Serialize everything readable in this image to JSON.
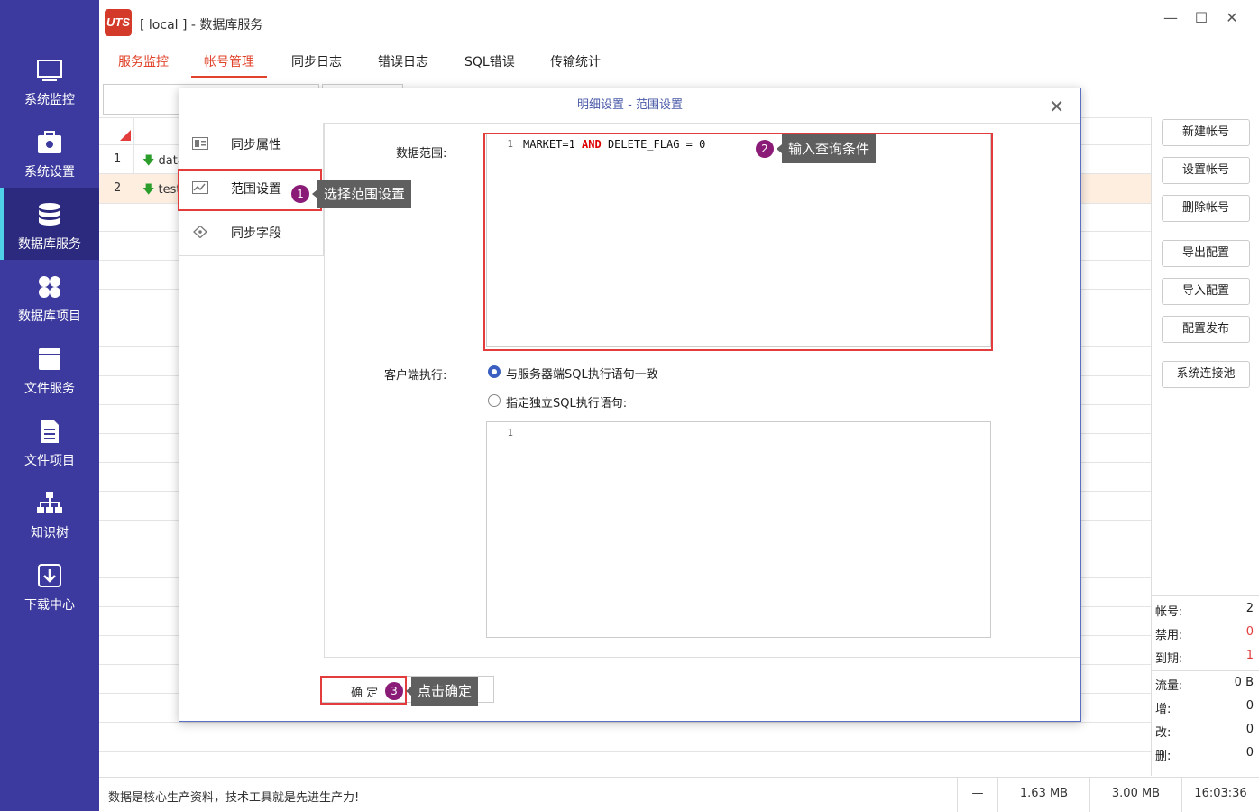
{
  "window": {
    "title": "[ local ] - 数据库服务",
    "logo_text": "UTS"
  },
  "sidebar": {
    "items": [
      {
        "label": "系统监控",
        "icon": "monitor-icon"
      },
      {
        "label": "系统设置",
        "icon": "settings-briefcase-icon"
      },
      {
        "label": "数据库服务",
        "icon": "database-icon"
      },
      {
        "label": "数据库项目",
        "icon": "clover-grid-icon"
      },
      {
        "label": "文件服务",
        "icon": "file-box-icon"
      },
      {
        "label": "文件项目",
        "icon": "file-list-icon"
      },
      {
        "label": "知识树",
        "icon": "tree-icon"
      },
      {
        "label": "下载中心",
        "icon": "download-icon"
      }
    ]
  },
  "tabs": [
    "服务监控",
    "帐号管理",
    "同步日志",
    "错误日志",
    "SQL错误",
    "传输统计"
  ],
  "table": {
    "rows": [
      {
        "num": "1",
        "name": "data"
      },
      {
        "num": "2",
        "name": "test"
      }
    ]
  },
  "right_buttons": [
    "新建帐号",
    "设置帐号",
    "删除帐号",
    "导出配置",
    "导入配置",
    "配置发布",
    "系统连接池"
  ],
  "stats": [
    {
      "label": "帐号:",
      "value": "2"
    },
    {
      "label": "禁用:",
      "value": "0"
    },
    {
      "label": "到期:",
      "value": "1"
    },
    {
      "label": "流量:",
      "value": "0 B"
    },
    {
      "label": "增:",
      "value": "0"
    },
    {
      "label": "改:",
      "value": "0"
    },
    {
      "label": "删:",
      "value": "0"
    }
  ],
  "statusbar": {
    "message": "数据是核心生产资料，技术工具就是先进生产力!",
    "dash": "—",
    "mem1": "1.63 MB",
    "mem2": "3.00 MB",
    "time": "16:03:36"
  },
  "dialog": {
    "title": "明细设置 - 范围设置",
    "side_items": [
      "同步属性",
      "范围设置",
      "同步字段"
    ],
    "data_range_label": "数据范围:",
    "editor1": {
      "line": "1",
      "code_a": "MARKET=1 ",
      "code_kw": "AND",
      "code_b": " DELETE_FLAG = 0"
    },
    "client_exec_label": "客户端执行:",
    "radio1": "与服务器端SQL执行语句一致",
    "radio2": "指定独立SQL执行语句:",
    "editor2": {
      "line": "1"
    },
    "ok_button": "确 定"
  },
  "annotations": [
    {
      "num": "1",
      "text": "选择范围设置"
    },
    {
      "num": "2",
      "text": "输入查询条件"
    },
    {
      "num": "3",
      "text": "点击确定"
    }
  ],
  "colors": {
    "sidebar": "#3c3a9e",
    "accent": "#e0432a",
    "badge": "#8a1c78",
    "highlight": "#e23c3c"
  }
}
